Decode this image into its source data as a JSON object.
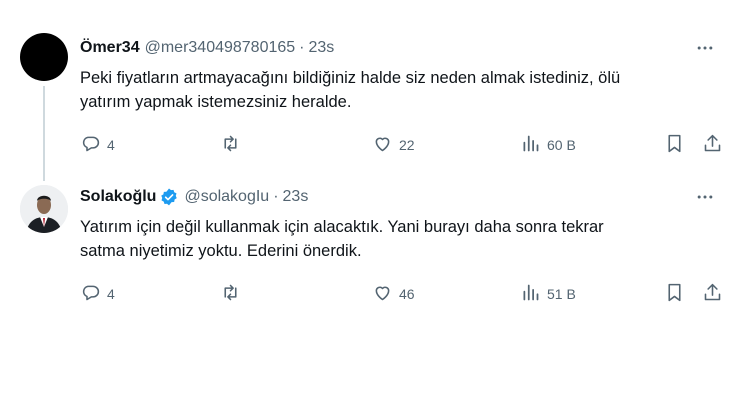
{
  "tweets": [
    {
      "name": "Ömer34",
      "handle": "@mer340498780165",
      "separator": "·",
      "time": "23s",
      "verified": false,
      "text_lines": [
        "Peki fiyatların artmayacağını bildiğiniz halde siz neden almak istediniz, ölü",
        "yatırım yapmak istemezsiniz heralde."
      ],
      "replies": "4",
      "retweets": "",
      "likes": "22",
      "views": "60 B"
    },
    {
      "name": "Solakoğlu",
      "handle": "@solakogIu",
      "separator": "·",
      "time": "23s",
      "verified": true,
      "text_lines": [
        "Yatırım için değil kullanmak için alacaktık. Yani burayı daha sonra tekrar",
        "satma niyetimiz yoktu. Ederini önerdik."
      ],
      "replies": "4",
      "retweets": "",
      "likes": "46",
      "views": "51 B"
    }
  ],
  "colors": {
    "text": "#0f1419",
    "secondary": "#536471",
    "thread_line": "#cfd9de",
    "verified": "#1d9bf0"
  },
  "icons": {
    "more": "more-icon",
    "reply": "reply-icon",
    "retweet": "retweet-icon",
    "like": "like-icon",
    "views": "views-icon",
    "bookmark": "bookmark-icon",
    "share": "share-icon"
  }
}
